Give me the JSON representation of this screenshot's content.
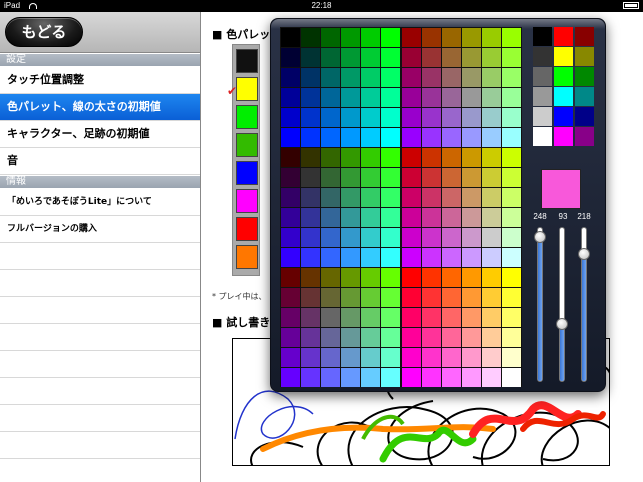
{
  "statusbar": {
    "device": "iPad",
    "time": "22:18"
  },
  "topbar": {
    "back_label": "もどる"
  },
  "sidebar": {
    "section_settings": "設定",
    "section_info": "情報",
    "items": [
      {
        "label": "タッチ位置調整"
      },
      {
        "label": "色パレット、線の太さの初期値"
      },
      {
        "label": "キャラクター、足跡の初期値"
      },
      {
        "label": "音"
      },
      {
        "label": "「めいろであそぼうLite」について"
      },
      {
        "label": "フルバージョンの購入"
      }
    ]
  },
  "main": {
    "palette_heading": "■ 色パレッ",
    "test_heading": "■ 試し書き",
    "note": "* プレイ中は、",
    "palette_colors": [
      "#111111",
      "#ffff00",
      "#00ee00",
      "#33bb00",
      "#0000ff",
      "#ff00ff",
      "#ff0000",
      "#ff7700"
    ],
    "selected_index": 1
  },
  "picker": {
    "selected_color": "#f858da",
    "rgb": {
      "r": 248,
      "g": 93,
      "b": 218
    },
    "rgb_labels": {
      "r": "248",
      "g": "93",
      "b": "218"
    },
    "side_colors": [
      "#000000",
      "#ff0000",
      "#880000",
      "#333333",
      "#ffff00",
      "#888800",
      "#666666",
      "#00ff00",
      "#008800",
      "#999999",
      "#00ffff",
      "#008888",
      "#cccccc",
      "#0000ff",
      "#000088",
      "#ffffff",
      "#ff00ff",
      "#880088"
    ]
  }
}
